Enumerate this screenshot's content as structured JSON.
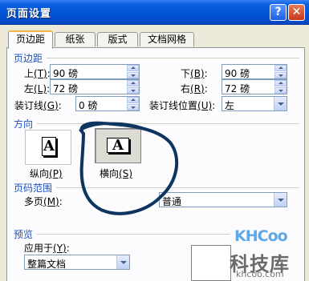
{
  "window": {
    "title": "页面设置",
    "help_label": "?",
    "close_label": "✕"
  },
  "tabs": [
    {
      "label": "页边距",
      "active": true
    },
    {
      "label": "纸张",
      "active": false
    },
    {
      "label": "版式",
      "active": false
    },
    {
      "label": "文档网格",
      "active": false
    }
  ],
  "margins": {
    "heading": "页边距",
    "top_label": "上",
    "top_key": "(T)",
    "top_value": "90 磅",
    "bottom_label": "下",
    "bottom_key": "(B)",
    "bottom_value": "90 磅",
    "left_label": "左",
    "left_key": "(L)",
    "left_value": "72 磅",
    "right_label": "右",
    "right_key": "(R)",
    "right_value": "72 磅",
    "gutter_label": "装订线",
    "gutter_key": "(G)",
    "gutter_value": "0 磅",
    "gutter_pos_label": "装订线位置",
    "gutter_pos_key": "(U)",
    "gutter_pos_value": "左"
  },
  "orientation": {
    "heading": "方向",
    "portrait_label": "纵向",
    "portrait_key": "(P)",
    "landscape_label": "横向",
    "landscape_key": "(S)",
    "glyph": "A",
    "selected": "landscape"
  },
  "pages": {
    "heading": "页码范围",
    "multi_label": "多页",
    "multi_key": "(M)",
    "multi_value": "普通"
  },
  "preview": {
    "heading": "预览",
    "apply_label": "应用于",
    "apply_key": "(Y)",
    "apply_value": "整篇文档"
  },
  "watermark": {
    "logo": "KHCoo",
    "main": "科技库",
    "url": "khcoo.com"
  },
  "colors": {
    "titlebar": "#0454d8",
    "section_text": "#1c4fc2",
    "annotation_stroke": "#0e3460",
    "active_tab_accent": "#f4b54a"
  }
}
